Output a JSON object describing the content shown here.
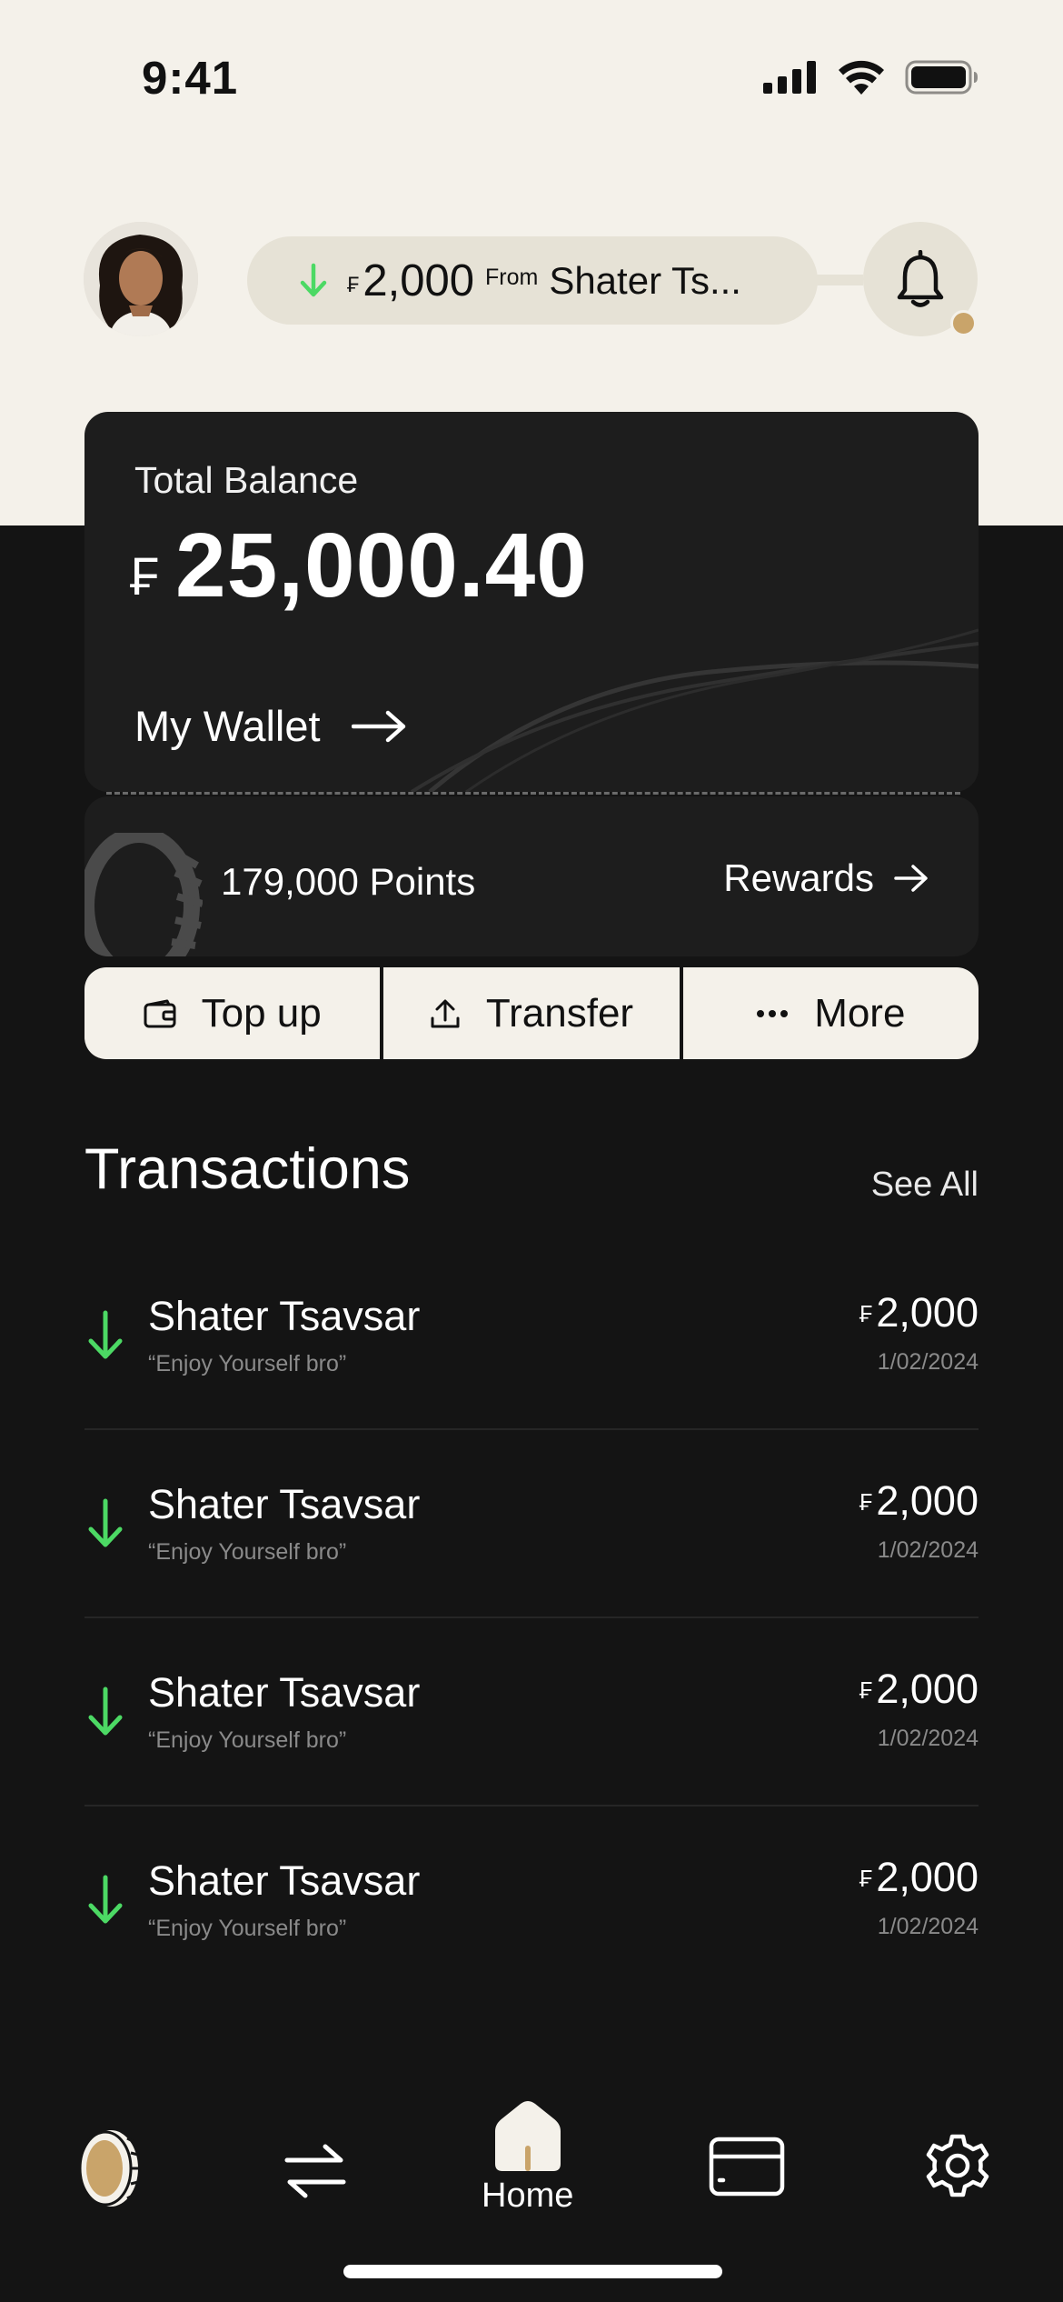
{
  "status_bar": {
    "time": "9:41"
  },
  "header": {
    "notification": {
      "currency": "₣",
      "amount": "2,000",
      "from_label": "From",
      "sender": "Shater Ts..."
    }
  },
  "balance": {
    "label": "Total Balance",
    "currency": "₣",
    "amount": "25,000.40",
    "wallet_label": "My Wallet"
  },
  "points": {
    "text": "179,000 Points",
    "rewards_label": "Rewards"
  },
  "actions": [
    {
      "label": "Top up",
      "icon": "wallet-icon"
    },
    {
      "label": "Transfer",
      "icon": "upload-icon"
    },
    {
      "label": "More",
      "icon": "more-dots-icon"
    }
  ],
  "transactions": {
    "title": "Transactions",
    "see_all": "See All",
    "items": [
      {
        "name": "Shater Tsavsar",
        "note": "“Enjoy Yourself bro”",
        "currency": "₣",
        "amount": "2,000",
        "date": "1/02/2024",
        "direction": "incoming"
      },
      {
        "name": "Shater Tsavsar",
        "note": "“Enjoy Yourself bro”",
        "currency": "₣",
        "amount": "2,000",
        "date": "1/02/2024",
        "direction": "incoming"
      },
      {
        "name": "Shater Tsavsar",
        "note": "“Enjoy Yourself bro”",
        "currency": "₣",
        "amount": "2,000",
        "date": "1/02/2024",
        "direction": "incoming"
      },
      {
        "name": "Shater Tsavsar",
        "note": "“Enjoy Yourself bro”",
        "currency": "₣",
        "amount": "2,000",
        "date": "1/02/2024",
        "direction": "incoming"
      }
    ]
  },
  "bottom_nav": {
    "items": [
      {
        "icon": "coin-icon"
      },
      {
        "icon": "transfer-arrows-icon"
      },
      {
        "icon": "home-icon",
        "label": "Home",
        "active": true
      },
      {
        "icon": "card-icon"
      },
      {
        "icon": "settings-gear-icon"
      }
    ]
  },
  "colors": {
    "light_bg": "#f4f1ea",
    "dark_bg": "#141414",
    "card_bg": "#1d1d1d",
    "incoming_green": "#4cd964",
    "accent_gold": "#c9a46a"
  }
}
